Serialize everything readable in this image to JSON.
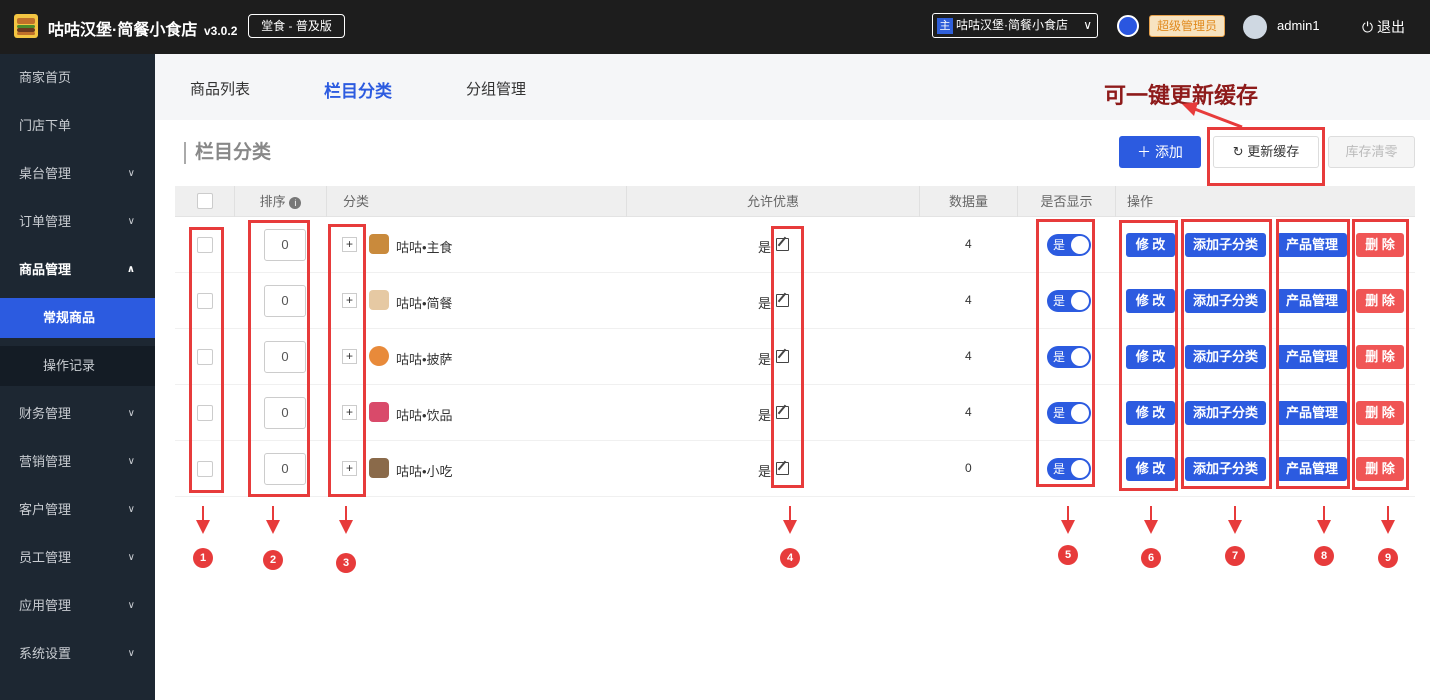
{
  "topbar": {
    "brand": "咕咕汉堡·简餐小食店",
    "version": "v3.0.2",
    "edition": "堂食 - 普及版",
    "store_tag": "主",
    "store_name": "咕咕汉堡·简餐小食店",
    "role_badge": "超级管理员",
    "username": "admin1",
    "logout": "退出"
  },
  "sidebar": {
    "items": [
      {
        "label": "商家首页"
      },
      {
        "label": "门店下单"
      },
      {
        "label": "桌台管理"
      },
      {
        "label": "订单管理"
      },
      {
        "label": "商品管理"
      },
      {
        "label": "常规商品"
      },
      {
        "label": "操作记录"
      },
      {
        "label": "财务管理"
      },
      {
        "label": "营销管理"
      },
      {
        "label": "客户管理"
      },
      {
        "label": "员工管理"
      },
      {
        "label": "应用管理"
      },
      {
        "label": "系统设置"
      }
    ],
    "active": "常规商品"
  },
  "tabs": [
    {
      "label": "商品列表"
    },
    {
      "label": "栏目分类"
    },
    {
      "label": "分组管理"
    }
  ],
  "annotation": "可一键更新缓存",
  "page": {
    "title": "栏目分类",
    "add": "添加",
    "refresh_cache": "更新缓存",
    "clear_stock": "库存清零"
  },
  "table": {
    "headers": [
      "排序",
      "分类",
      "允许优惠",
      "数据量",
      "是否显示",
      "操作"
    ],
    "rows": [
      {
        "sort": "0",
        "name": "咕咕•主食",
        "discount": "是",
        "count": "4",
        "show": "是"
      },
      {
        "sort": "0",
        "name": "咕咕•简餐",
        "discount": "是",
        "count": "4",
        "show": "是"
      },
      {
        "sort": "0",
        "name": "咕咕•披萨",
        "discount": "是",
        "count": "4",
        "show": "是"
      },
      {
        "sort": "0",
        "name": "咕咕•饮品",
        "discount": "是",
        "count": "4",
        "show": "是"
      },
      {
        "sort": "0",
        "name": "咕咕•小吃",
        "discount": "是",
        "count": "0",
        "show": "是"
      }
    ],
    "actions": {
      "edit": "修 改",
      "add_sub": "添加子分类",
      "products": "产品管理",
      "delete": "删 除"
    }
  },
  "markers": [
    "1",
    "2",
    "3",
    "4",
    "5",
    "6",
    "7",
    "8",
    "9"
  ],
  "colors": {
    "primary": "#2c5be0",
    "danger": "#f05555",
    "annotation": "#e73b3b",
    "sidebar": "#1d2732",
    "topbar": "#1d1d1d"
  }
}
